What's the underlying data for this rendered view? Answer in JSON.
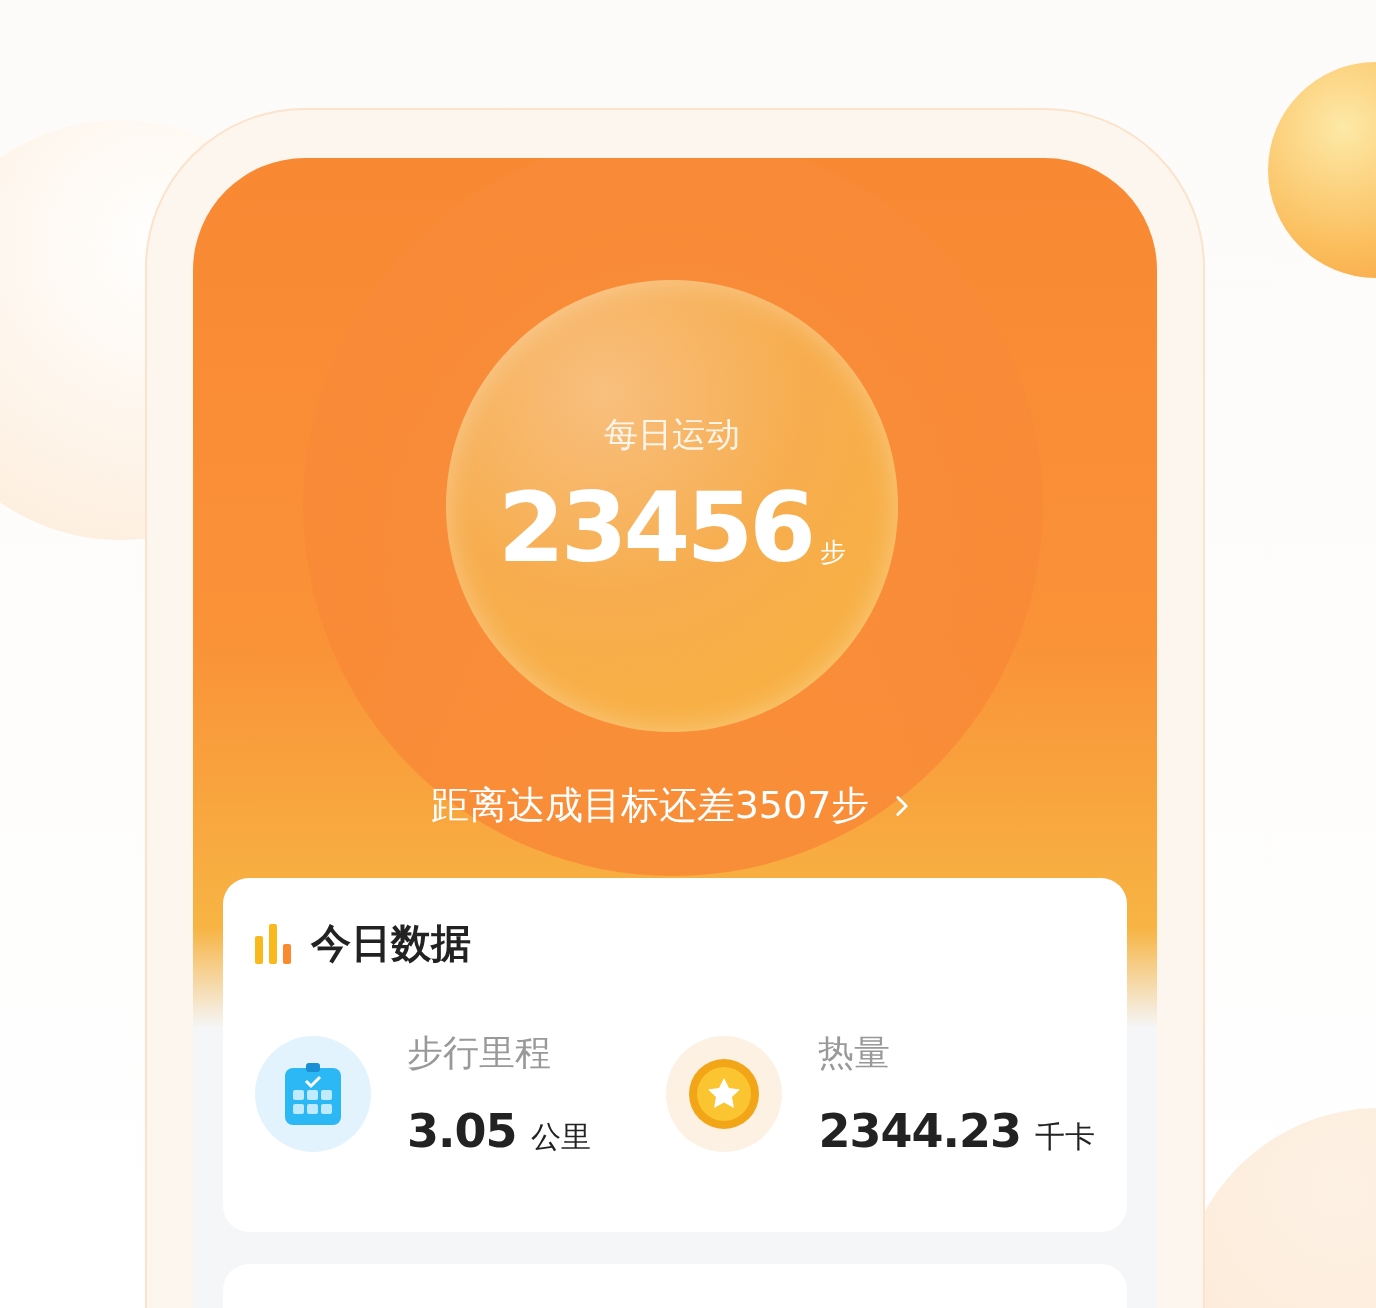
{
  "hero": {
    "title": "每日运动",
    "steps": "23456",
    "unit": "步",
    "goal_text": "距离达成目标还差3507步"
  },
  "today": {
    "title": "今日数据",
    "stats": [
      {
        "kind": "distance",
        "label": "步行里程",
        "value": "3.05",
        "unit": "公里"
      },
      {
        "kind": "calories",
        "label": "热量",
        "value": "2344.23",
        "unit": "千卡"
      }
    ]
  }
}
